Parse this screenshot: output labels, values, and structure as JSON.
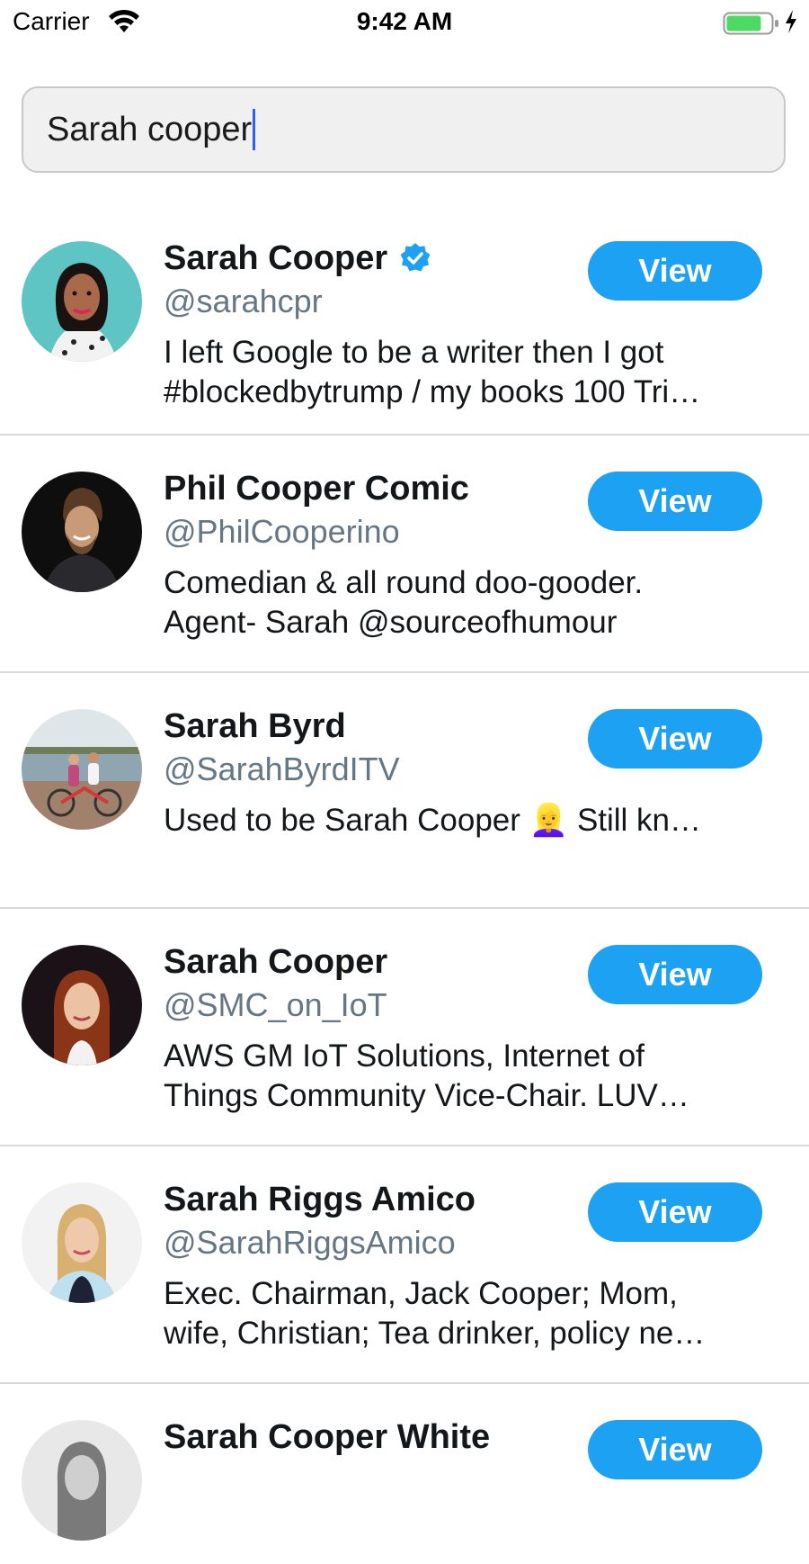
{
  "status_bar": {
    "carrier": "Carrier",
    "time": "9:42 AM",
    "icons": [
      "wifi-icon",
      "battery-icon",
      "charging-icon"
    ],
    "battery_color": "#4cd964"
  },
  "search": {
    "value": "Sarah cooper"
  },
  "colors": {
    "accent": "#1da1f2",
    "handle": "#657786",
    "caret": "#2f5ff2"
  },
  "results": [
    {
      "name": "Sarah Cooper",
      "verified": true,
      "handle": "@sarahcpr",
      "bio_line1": "I left Google to be a writer then I got",
      "bio_line2": "#blockedbytrump / my books 100 Tri…",
      "button": "View"
    },
    {
      "name": "Phil Cooper Comic",
      "verified": false,
      "handle": "@PhilCooperino",
      "bio_line1": "Comedian & all round doo-gooder.",
      "bio_line2": "Agent- Sarah @sourceofhumour",
      "button": "View"
    },
    {
      "name": "Sarah Byrd",
      "verified": false,
      "handle": "@SarahByrdITV",
      "bio_line1": "Used to be Sarah Cooper 👱‍♀️ Still kn…",
      "bio_line2": "",
      "button": "View"
    },
    {
      "name": "Sarah Cooper",
      "verified": false,
      "handle": "@SMC_on_IoT",
      "bio_line1": "AWS GM IoT Solutions, Internet of",
      "bio_line2": "Things Community Vice-Chair. LUV…",
      "button": "View"
    },
    {
      "name": "Sarah Riggs Amico",
      "verified": false,
      "handle": "@SarahRiggsAmico",
      "bio_line1": "Exec. Chairman, Jack Cooper; Mom,",
      "bio_line2": "wife, Christian; Tea drinker, policy ne…",
      "button": "View"
    },
    {
      "name": "Sarah Cooper White",
      "verified": false,
      "handle": "",
      "bio_line1": "",
      "bio_line2": "",
      "button": "View"
    }
  ]
}
